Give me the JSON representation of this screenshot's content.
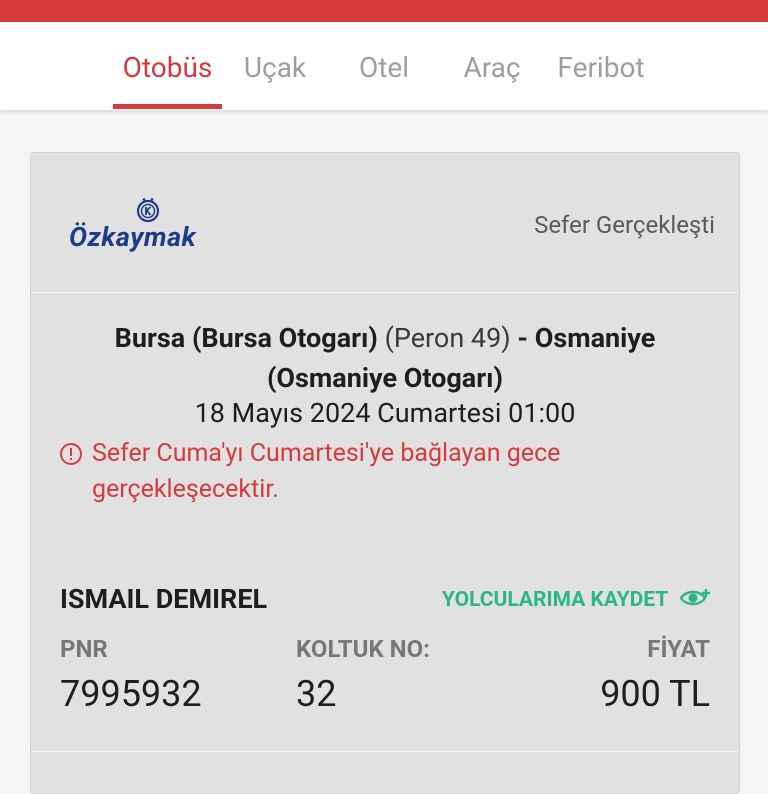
{
  "header": {
    "accent_color": "#d63a3c",
    "tabs": [
      {
        "label": "Otobüs",
        "active": true
      },
      {
        "label": "Uçak",
        "active": false
      },
      {
        "label": "Otel",
        "active": false
      },
      {
        "label": "Araç",
        "active": false
      },
      {
        "label": "Feribot",
        "active": false
      }
    ]
  },
  "ticket": {
    "company": "Özkaymak",
    "status": "Sefer Gerçekleşti",
    "route": {
      "origin": "Bursa (Bursa Otogarı)",
      "platform": "(Peron 49)",
      "separator": "-",
      "destination_line1": "Osmaniye",
      "destination_line2": "(Osmaniye Otogarı)"
    },
    "datetime": "18 Mayıs 2024 Cumartesi 01:00",
    "warning": "Sefer Cuma'yı Cumartesi'ye bağlayan gece gerçekleşecektir.",
    "passenger": "ISMAIL DEMIREL",
    "save_label": "YOLCULARIMA KAYDET",
    "labels": {
      "pnr": "PNR",
      "seat": "KOLTUK NO:",
      "price": "FİYAT"
    },
    "values": {
      "pnr": "7995932",
      "seat": "32",
      "price": "900 TL"
    },
    "colors": {
      "save": "#2bb58a",
      "warning": "#d63a3c",
      "logo": "#1d3b8a"
    }
  }
}
